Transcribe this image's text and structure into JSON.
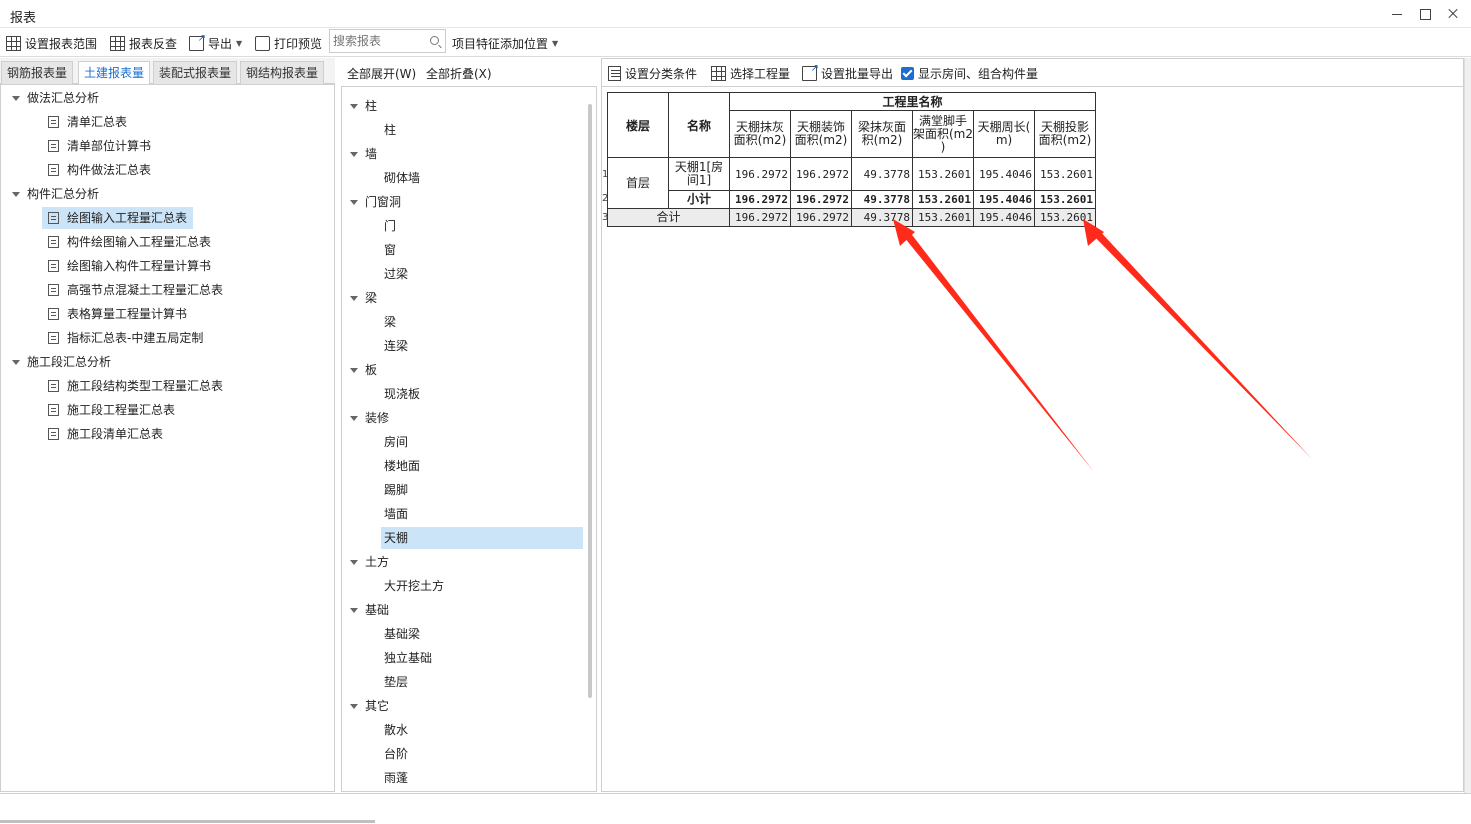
{
  "window": {
    "title": "报表"
  },
  "toolbar": {
    "set_range": "设置报表范围",
    "report_check": "报表反查",
    "export": "导出",
    "print_preview": "打印预览",
    "search_placeholder": "搜索报表",
    "feature_position": "项目特征添加位置"
  },
  "tabs": [
    "钢筋报表量",
    "土建报表量",
    "装配式报表量",
    "钢结构报表量"
  ],
  "active_tab": 1,
  "left_tree": {
    "groups": [
      {
        "label": "做法汇总分析",
        "items": [
          "清单汇总表",
          "清单部位计算书",
          "构件做法汇总表"
        ]
      },
      {
        "label": "构件汇总分析",
        "items": [
          "绘图输入工程量汇总表",
          "构件绘图输入工程量汇总表",
          "绘图输入构件工程量计算书",
          "高强节点混凝土工程量汇总表",
          "表格算量工程量计算书",
          "指标汇总表-中建五局定制"
        ]
      },
      {
        "label": "施工段汇总分析",
        "items": [
          "施工段结构类型工程量汇总表",
          "施工段工程量汇总表",
          "施工段清单汇总表"
        ]
      }
    ],
    "selected": "绘图输入工程量汇总表"
  },
  "middle": {
    "expand_all": "全部展开(W)",
    "collapse_all": "全部折叠(X)",
    "groups": [
      {
        "label": "柱",
        "items": [
          "柱"
        ]
      },
      {
        "label": "墙",
        "items": [
          "砌体墙"
        ]
      },
      {
        "label": "门窗洞",
        "items": [
          "门",
          "窗",
          "过梁"
        ]
      },
      {
        "label": "梁",
        "items": [
          "梁",
          "连梁"
        ]
      },
      {
        "label": "板",
        "items": [
          "现浇板"
        ]
      },
      {
        "label": "装修",
        "items": [
          "房间",
          "楼地面",
          "踢脚",
          "墙面",
          "天棚"
        ]
      },
      {
        "label": "土方",
        "items": [
          "大开挖土方"
        ]
      },
      {
        "label": "基础",
        "items": [
          "基础梁",
          "独立基础",
          "垫层"
        ]
      },
      {
        "label": "其它",
        "items": [
          "散水",
          "台阶",
          "雨蓬"
        ]
      }
    ],
    "selected": "天棚"
  },
  "right_toolbar": {
    "set_category": "设置分类条件",
    "select_quantity": "选择工程量",
    "batch_export": "设置批量导出",
    "show_rooms": "显示房间、组合构件量",
    "show_rooms_checked": true
  },
  "report": {
    "col_floor": "楼层",
    "col_name": "名称",
    "group_header": "工程里名称",
    "columns": [
      "天棚抹灰\n面积(m2)",
      "天棚装饰\n面积(m2)",
      "梁抹灰面\n积(m2)",
      "满堂脚手\n架面积(m2\n)",
      "天棚周长(\nm)",
      "天棚投影\n面积(m2)"
    ],
    "row_numbers": [
      "1",
      "2",
      "3"
    ],
    "floor": "首层",
    "row1_name": "天棚1[房\n间1]",
    "row1_values": [
      "196.2972",
      "196.2972",
      "49.3778",
      "153.2601",
      "195.4046",
      "153.2601"
    ],
    "subtotal_label": "小计",
    "subtotal_values": [
      "196.2972",
      "196.2972",
      "49.3778",
      "153.2601",
      "195.4046",
      "153.2601"
    ],
    "total_label": "合计",
    "total_values": [
      "196.2972",
      "196.2972",
      "49.3778",
      "153.2601",
      "195.4046",
      "153.2601"
    ]
  },
  "colors": {
    "accent": "#1a6fd0",
    "selection": "#cce4f7",
    "arrow": "#ff2a1a"
  }
}
